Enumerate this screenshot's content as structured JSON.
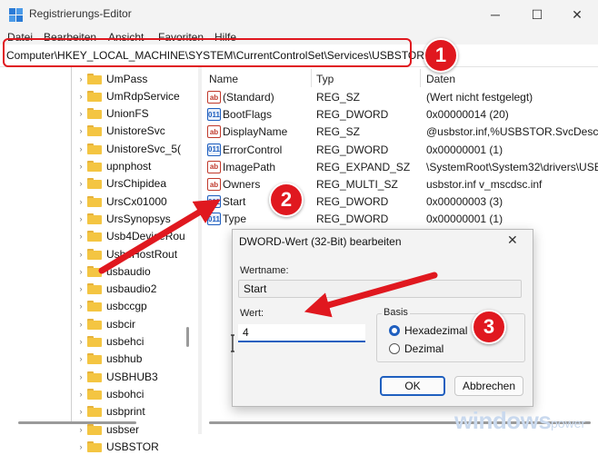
{
  "window": {
    "title": "Registrierungs-Editor",
    "minimize_icon": "minimize-icon",
    "maximize_icon": "maximize-icon",
    "close_icon": "close-icon"
  },
  "menu": [
    "Datei",
    "Bearbeiten",
    "Ansicht",
    "Favoriten",
    "Hilfe"
  ],
  "address": {
    "path": "Computer\\HKEY_LOCAL_MACHINE\\SYSTEM\\CurrentControlSet\\Services\\USBSTOR"
  },
  "tree": [
    "UmPass",
    "UmRdpService",
    "UnionFS",
    "UnistoreSvc",
    "UnistoreSvc_5(",
    "upnphost",
    "UrsChipidea",
    "UrsCx01000",
    "UrsSynopsys",
    "Usb4DeviceRou",
    "Usb4HostRout",
    "usbaudio",
    "usbaudio2",
    "usbccgp",
    "usbcir",
    "usbehci",
    "usbhub",
    "USBHUB3",
    "usbohci",
    "usbprint",
    "usbser",
    "USBSTOR"
  ],
  "columns": {
    "name": "Name",
    "type": "Typ",
    "data": "Daten"
  },
  "values": [
    {
      "name": "(Standard)",
      "type": "REG_SZ",
      "data": "(Wert nicht festgelegt)",
      "icon": "string-value-icon"
    },
    {
      "name": "BootFlags",
      "type": "REG_DWORD",
      "data": "0x00000014 (20)",
      "icon": "dword-value-icon"
    },
    {
      "name": "DisplayName",
      "type": "REG_SZ",
      "data": "@usbstor.inf,%USBSTOR.SvcDesc%;",
      "icon": "string-value-icon"
    },
    {
      "name": "ErrorControl",
      "type": "REG_DWORD",
      "data": "0x00000001 (1)",
      "icon": "dword-value-icon"
    },
    {
      "name": "ImagePath",
      "type": "REG_EXPAND_SZ",
      "data": "\\SystemRoot\\System32\\drivers\\USB",
      "icon": "string-value-icon"
    },
    {
      "name": "Owners",
      "type": "REG_MULTI_SZ",
      "data": "usbstor.inf v_mscdsc.inf",
      "icon": "string-value-icon"
    },
    {
      "name": "Start",
      "type": "REG_DWORD",
      "data": "0x00000003 (3)",
      "icon": "dword-value-icon"
    },
    {
      "name": "Type",
      "type": "REG_DWORD",
      "data": "0x00000001 (1)",
      "icon": "dword-value-icon"
    }
  ],
  "dialog": {
    "title": "DWORD-Wert (32-Bit) bearbeiten",
    "name_label": "Wertname:",
    "name_value": "Start",
    "value_label": "Wert:",
    "value_value": "4",
    "basis_label": "Basis",
    "hex_label": "Hexadezimal",
    "dec_label": "Dezimal",
    "ok_label": "OK",
    "cancel_label": "Abbrechen"
  },
  "badges": {
    "b1": "1",
    "b2": "2",
    "b3": "3"
  },
  "watermark": {
    "main": "windows",
    "suffix": "power"
  },
  "colors": {
    "accent": "#1f5fbf",
    "annotation": "#e0181f",
    "folder": "#f4c542"
  }
}
